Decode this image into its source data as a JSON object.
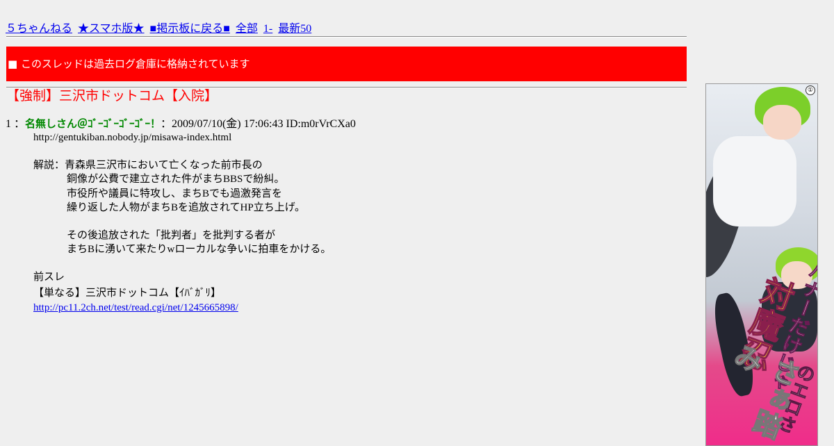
{
  "nav": {
    "links": [
      "５ちゃんねる",
      "★スマホ版★",
      "■掲示板に戻る■",
      "全部",
      "1-",
      "最新50"
    ]
  },
  "banner": {
    "text": "■ このスレッドは過去ログ倉庫に格納されています"
  },
  "thread": {
    "title": "【強制】三沢市ドットコム【入院】"
  },
  "post": {
    "number": "1",
    "sep1": "：",
    "name": "名無しさん＠ｺﾞｰｺﾞｰｺﾞｰｺﾞｰ！",
    "sep2": "：",
    "date": "2009/07/10(金) 17:06:43",
    "id": "ID:m0rVrCXa0",
    "body": {
      "url_line": "http://gentukiban.nobody.jp/misawa-index.html",
      "desc_label": "解説：",
      "desc_lines": [
        "青森県三沢市において亡くなった前市長の",
        "銅像が公費で建立された件がまちBBSで紛糾。",
        "市役所や議員に特攻し、まちBでも過激発言を",
        "繰り返した人物がまちBを追放されてHP立ち上げ。"
      ],
      "desc_lines2": [
        "その後追放された「批判者」を批判する者が",
        "まちBに湧いて来たりwローカルな争いに拍車をかける。"
      ],
      "prev_label": "前スレ",
      "prev_title": "【単なる】三沢市ドットコム【ｲﾊﾞｶﾞﾘ】",
      "prev_link": "http://pc11.2ch.net/test/read.cgi/net/1245665898/"
    }
  },
  "ad": {
    "badge": "①",
    "text1": "バナーだけじゃ",
    "text2": "対魔忍",
    "text3": "のエロさ",
    "text4": "さぁ踏み"
  },
  "colors": {
    "page_bg": "#efefef",
    "banner_bg": "#ff0000",
    "title_red": "#ff0000",
    "name_green": "#008800",
    "link_blue": "#0000ee"
  }
}
